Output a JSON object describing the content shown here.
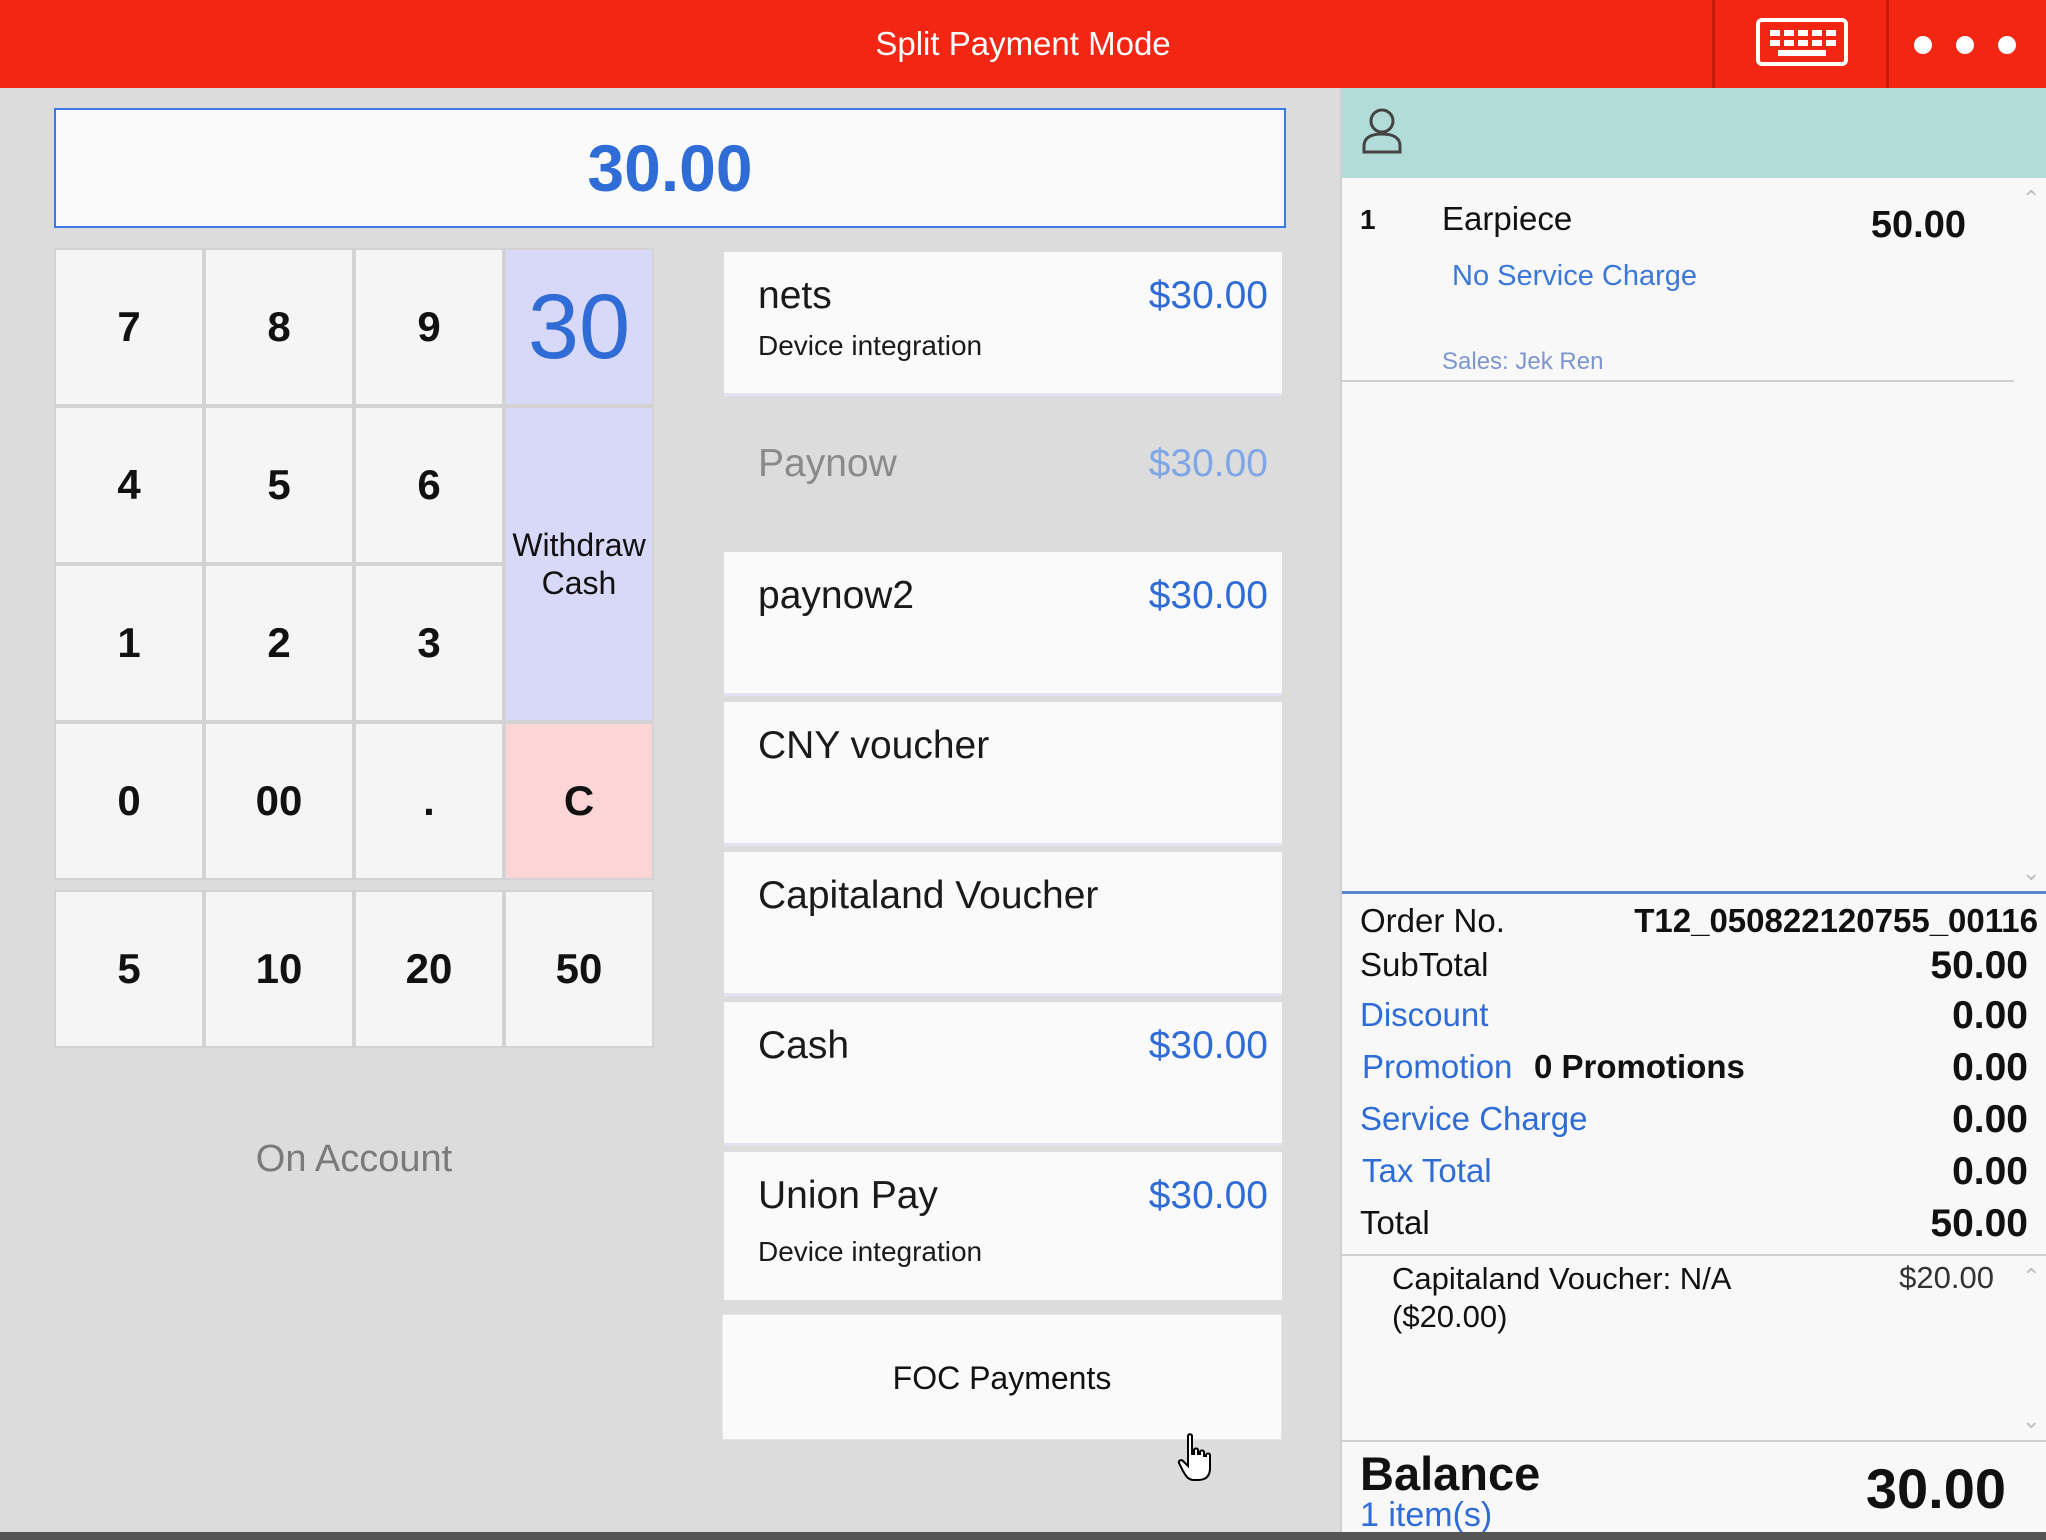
{
  "header": {
    "title": "Split Payment Mode",
    "keyboard_icon": "keyboard-icon",
    "more_icon": "more-horizontal-icon",
    "color": "#f22613"
  },
  "amount_display": "30.00",
  "keypad": {
    "keys": [
      "7",
      "8",
      "9",
      "4",
      "5",
      "6",
      "1",
      "2",
      "3",
      "0",
      "00",
      "."
    ],
    "preset_amount": "30",
    "withdraw_cash": "Withdraw\nCash",
    "clear": "C",
    "quick_amounts": [
      "5",
      "10",
      "20",
      "50"
    ]
  },
  "on_account": "On Account",
  "payment_methods": [
    {
      "name": "nets",
      "amount": "$30.00",
      "sub": "Device integration",
      "enabled": true
    },
    {
      "name": "Paynow",
      "amount": "$30.00",
      "sub": "",
      "enabled": false
    },
    {
      "name": "paynow2",
      "amount": "$30.00",
      "sub": "",
      "enabled": true
    },
    {
      "name": "CNY voucher",
      "amount": "",
      "sub": "",
      "enabled": true
    },
    {
      "name": "Capitaland Voucher",
      "amount": "",
      "sub": "",
      "enabled": true
    },
    {
      "name": "Cash",
      "amount": "$30.00",
      "sub": "",
      "enabled": true
    },
    {
      "name": "Union Pay",
      "amount": "$30.00",
      "sub": "Device integration",
      "enabled": true
    }
  ],
  "foc_payments": "FOC Payments",
  "order": {
    "items": [
      {
        "index": "1",
        "name": "Earpiece",
        "price": "50.00",
        "service_charge": "No Service Charge",
        "sales": "Sales: Jek Ren"
      }
    ],
    "order_no_label": "Order No.",
    "order_no": "T12_050822120755_00116",
    "subtotal_label": "SubTotal",
    "subtotal": "50.00",
    "discount_label": "Discount",
    "discount": "0.00",
    "promotion_label": "Promotion",
    "promotion_count": "0 Promotions",
    "promotion": "0.00",
    "service_charge_label": "Service Charge",
    "service_charge": "0.00",
    "tax_label": "Tax Total",
    "tax": "0.00",
    "total_label": "Total",
    "total": "50.00",
    "payments": [
      {
        "name": "Capitaland Voucher: N/A ($20.00)",
        "amount": "$20.00"
      }
    ],
    "balance_label": "Balance",
    "items_count": "1 item(s)",
    "balance": "30.00"
  },
  "colors": {
    "accent_blue": "#2f6cd6",
    "preset_bg": "#d8d9f8",
    "clear_bg": "#fcd6d6",
    "customer_bar": "#b2dcd7"
  }
}
